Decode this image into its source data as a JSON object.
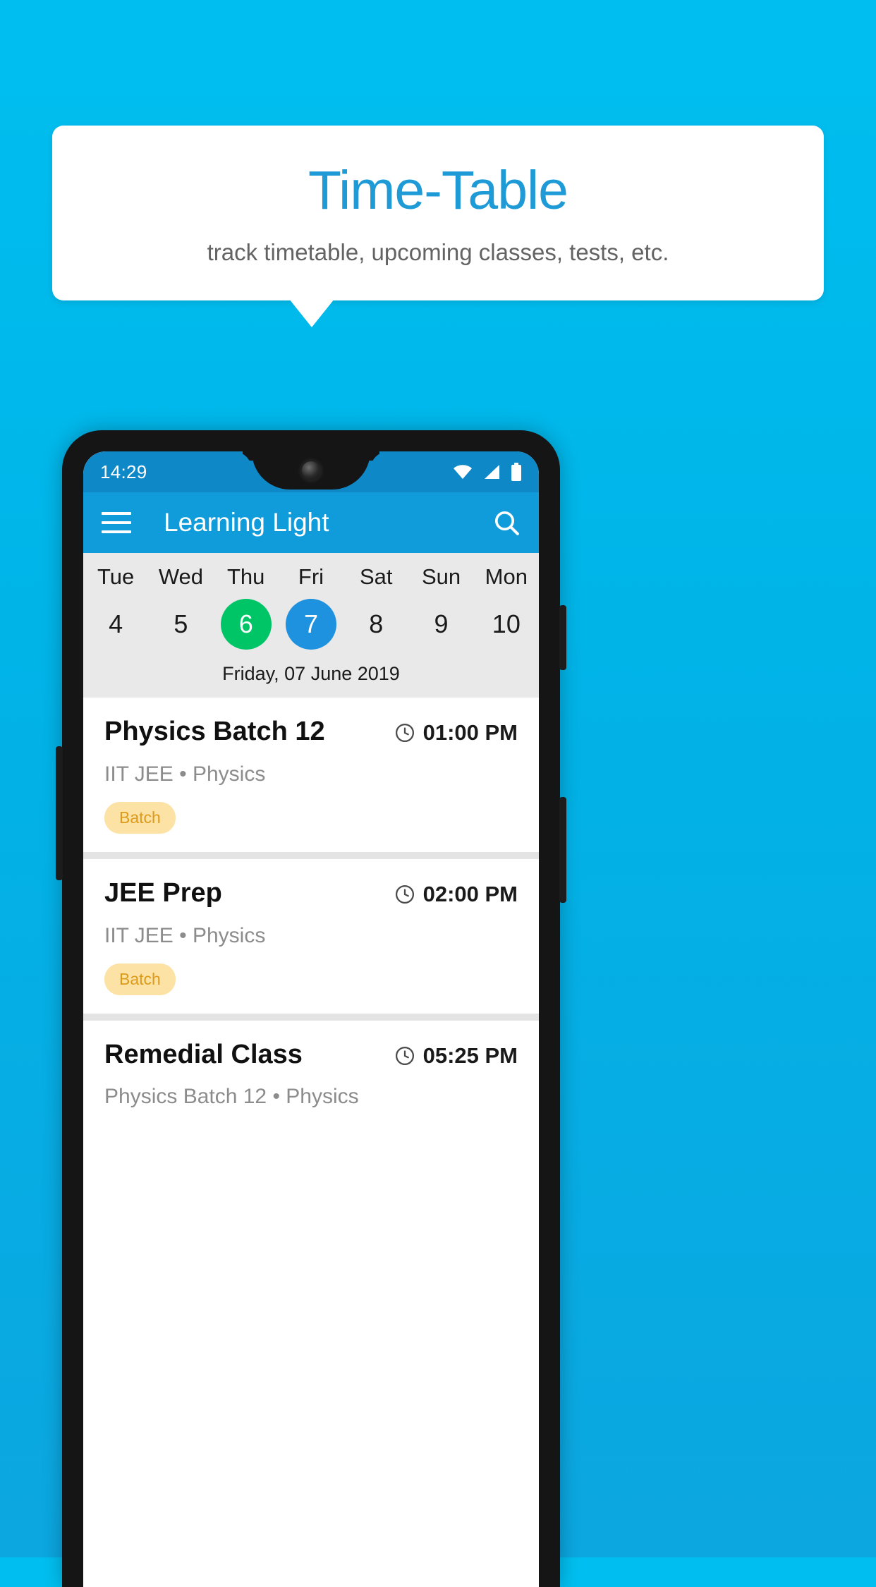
{
  "promo": {
    "title": "Time-Table",
    "subtitle": "track timetable, upcoming classes, tests, etc."
  },
  "colors": {
    "background": "#00BFF0",
    "title": "#1E9BD7",
    "appbar": "#109BDB",
    "statusbar": "#0F88C8",
    "today": "#00C566",
    "selected": "#1E91DF",
    "badge_bg": "#FCE2A4",
    "badge_text": "#DD9B1C"
  },
  "phone": {
    "statusbar": {
      "time": "14:29",
      "icons": [
        "wifi-icon",
        "signal-icon",
        "battery-icon"
      ]
    },
    "appbar": {
      "menu_icon": "hamburger-menu-icon",
      "title": "Learning Light",
      "search_icon": "search-icon"
    },
    "calendar": {
      "days": [
        {
          "name": "Tue",
          "num": "4",
          "state": "normal"
        },
        {
          "name": "Wed",
          "num": "5",
          "state": "normal"
        },
        {
          "name": "Thu",
          "num": "6",
          "state": "today"
        },
        {
          "name": "Fri",
          "num": "7",
          "state": "selected"
        },
        {
          "name": "Sat",
          "num": "8",
          "state": "normal"
        },
        {
          "name": "Sun",
          "num": "9",
          "state": "normal"
        },
        {
          "name": "Mon",
          "num": "10",
          "state": "normal"
        }
      ],
      "full_date": "Friday, 07 June 2019"
    },
    "classes": [
      {
        "title": "Physics Batch 12",
        "time": "01:00 PM",
        "subtitle": "IIT JEE • Physics",
        "badge": "Batch"
      },
      {
        "title": "JEE Prep",
        "time": "02:00 PM",
        "subtitle": "IIT JEE • Physics",
        "badge": "Batch"
      },
      {
        "title": "Remedial Class",
        "time": "05:25 PM",
        "subtitle": "Physics Batch 12 • Physics",
        "badge": ""
      }
    ]
  }
}
